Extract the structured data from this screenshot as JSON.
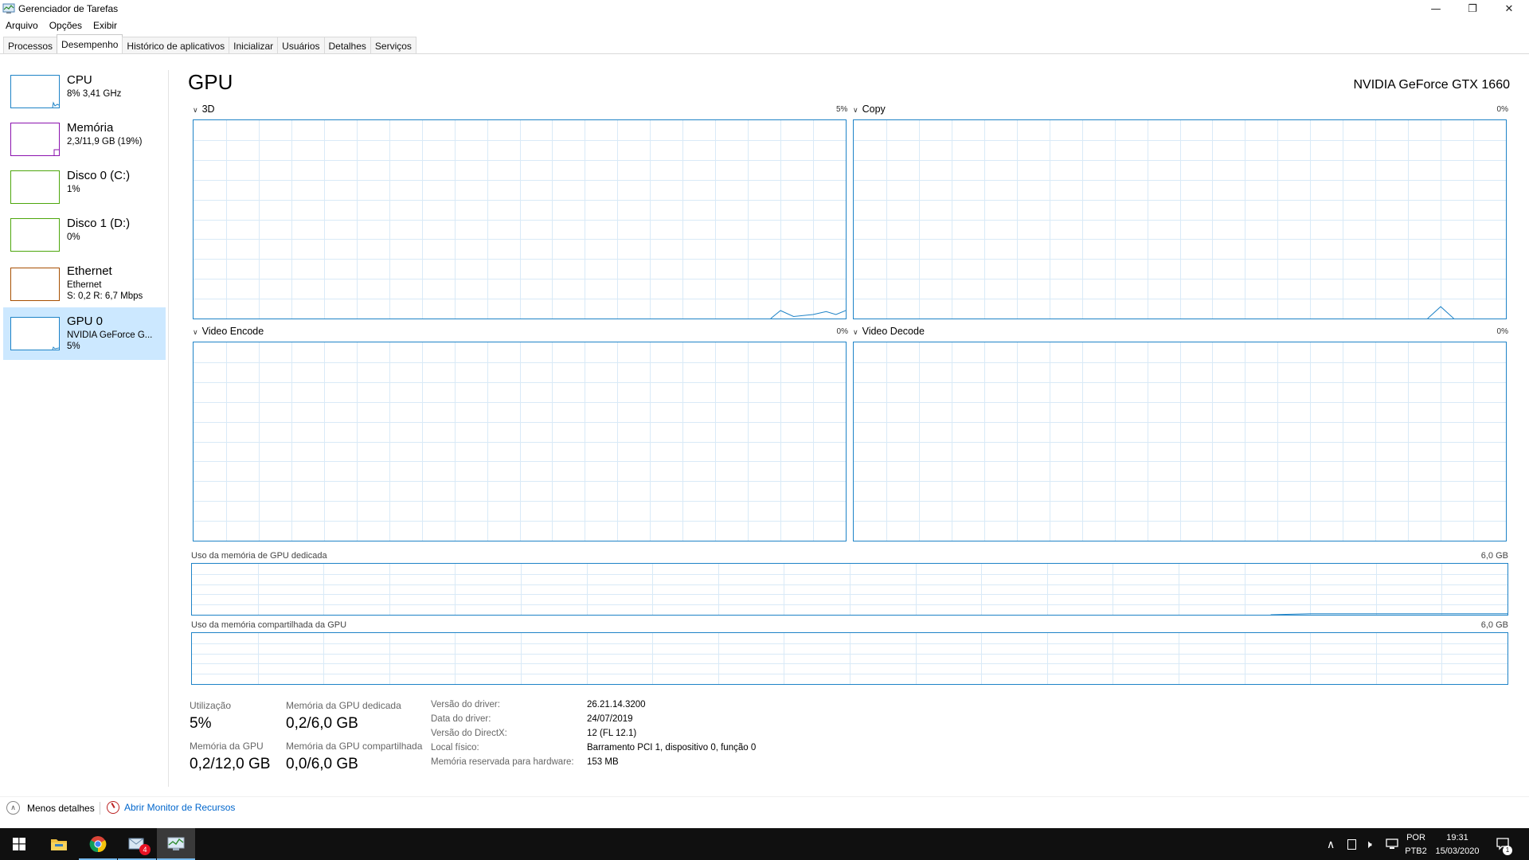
{
  "window": {
    "title": "Gerenciador de Tarefas",
    "minimize_glyph": "—",
    "restore_glyph": "❐",
    "close_glyph": "✕"
  },
  "menu": [
    "Arquivo",
    "Opções",
    "Exibir"
  ],
  "tabs": [
    "Processos",
    "Desempenho",
    "Histórico de aplicativos",
    "Inicializar",
    "Usuários",
    "Detalhes",
    "Serviços"
  ],
  "active_tab": "Desempenho",
  "sidebar": {
    "items": [
      {
        "name": "CPU",
        "line1": "8% 3,41 GHz",
        "line2": "",
        "color": "#1e83c7"
      },
      {
        "name": "Memória",
        "line1": "2,3/11,9 GB (19%)",
        "line2": "",
        "color": "#8b12ae"
      },
      {
        "name": "Disco 0 (C:)",
        "line1": "1%",
        "line2": "",
        "color": "#4da60c"
      },
      {
        "name": "Disco 1 (D:)",
        "line1": "0%",
        "line2": "",
        "color": "#4da60c"
      },
      {
        "name": "Ethernet",
        "line1": "Ethernet",
        "line2": "S: 0,2  R: 6,7 Mbps",
        "color": "#a74f01"
      },
      {
        "name": "GPU 0",
        "line1": "NVIDIA GeForce G...",
        "line2": "5%",
        "color": "#1e83c7"
      }
    ],
    "selected": "GPU 0"
  },
  "main": {
    "title": "GPU",
    "model": "NVIDIA GeForce GTX 1660",
    "engines": [
      {
        "label": "3D",
        "percent": "5%"
      },
      {
        "label": "Copy",
        "percent": "0%"
      },
      {
        "label": "Video Encode",
        "percent": "0%"
      },
      {
        "label": "Video Decode",
        "percent": "0%"
      }
    ],
    "dedicated_mem": {
      "label": "Uso da memória de GPU dedicada",
      "max": "6,0 GB"
    },
    "shared_mem": {
      "label": "Uso da memória compartilhada da GPU",
      "max": "6,0 GB"
    }
  },
  "stats": {
    "utilization": {
      "label": "Utilização",
      "value": "5%"
    },
    "dedicated": {
      "label": "Memória da GPU dedicada",
      "value": "0,2/6,0 GB"
    },
    "gpu_memory": {
      "label": "Memória da GPU",
      "value": "0,2/12,0 GB"
    },
    "shared": {
      "label": "Memória da GPU compartilhada",
      "value": "0,0/6,0 GB"
    }
  },
  "info": [
    {
      "key": "Versão do driver:",
      "value": "26.21.14.3200"
    },
    {
      "key": "Data do driver:",
      "value": "24/07/2019"
    },
    {
      "key": "Versão do DirectX:",
      "value": "12 (FL 12.1)"
    },
    {
      "key": "Local físico:",
      "value": "Barramento PCI 1, dispositivo 0, função 0"
    },
    {
      "key": "Memória reservada para hardware:",
      "value": "153 MB"
    }
  ],
  "footer": {
    "less_details": "Menos detalhes",
    "resource_monitor": "Abrir Monitor de Recursos"
  },
  "taskbar": {
    "mail_badge": "4",
    "lang_line1": "POR",
    "lang_line2": "PTB2",
    "time": "19:31",
    "date": "15/03/2020",
    "notification_count": "1"
  },
  "colors": {
    "accent": "#1e83c7",
    "grid": "#d9eaf7",
    "selection": "#cce8ff",
    "taskbar": "#101010"
  }
}
